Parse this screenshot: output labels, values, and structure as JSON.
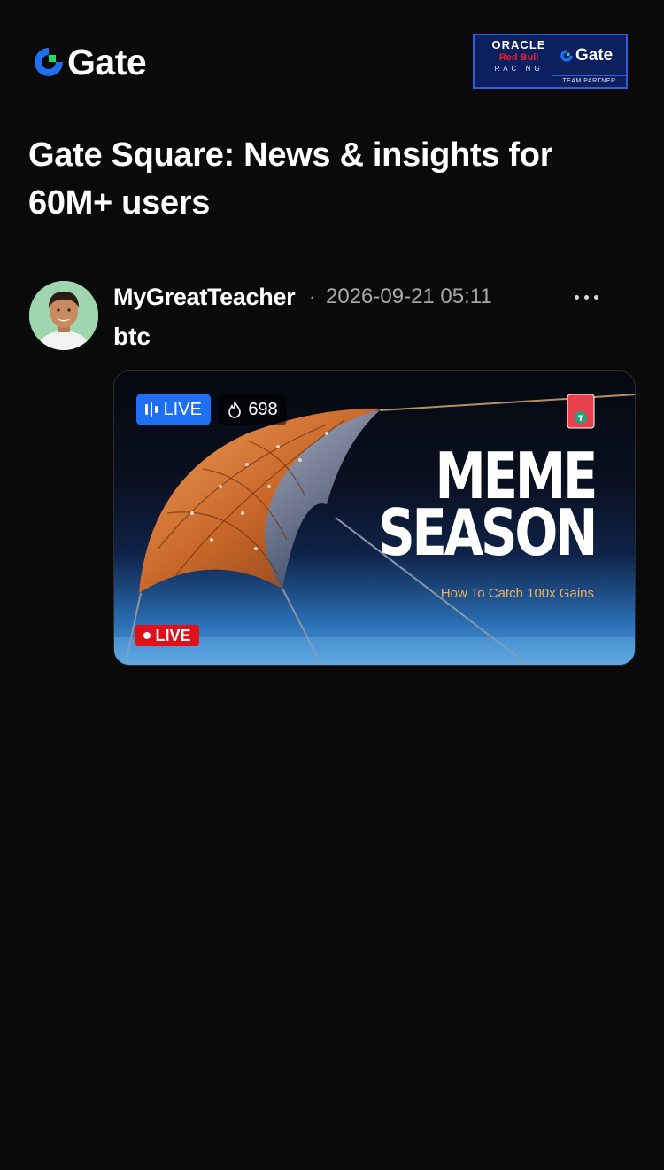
{
  "header": {
    "logo_text": "Gate",
    "partner": {
      "line1": "ORACLE",
      "line2": "Red Bull",
      "line3": "RACING",
      "brand": "Gate",
      "footer": "TEAM PARTNER"
    }
  },
  "page": {
    "title": "Gate Square: News & insights for 60M+ users"
  },
  "post": {
    "author": "MyGreatTeacher",
    "separator": "·",
    "timestamp": "2026-09-21 05:11",
    "text": "btc",
    "media": {
      "live_label": "LIVE",
      "heat_count": "698",
      "headline_line1": "MEME",
      "headline_line2": "SEASON",
      "subheadline": "How To Catch 100x Gains",
      "live_tag": "LIVE"
    }
  },
  "colors": {
    "background": "#0a0a0a",
    "brand_blue": "#1f6ff2",
    "brand_green": "#17e36b",
    "live_red": "#e0101a",
    "accent_orange": "#f0b35a"
  },
  "icons": [
    "gate-logo-icon",
    "more-options-icon",
    "live-bars-icon",
    "flame-icon",
    "tether-tag-icon"
  ]
}
